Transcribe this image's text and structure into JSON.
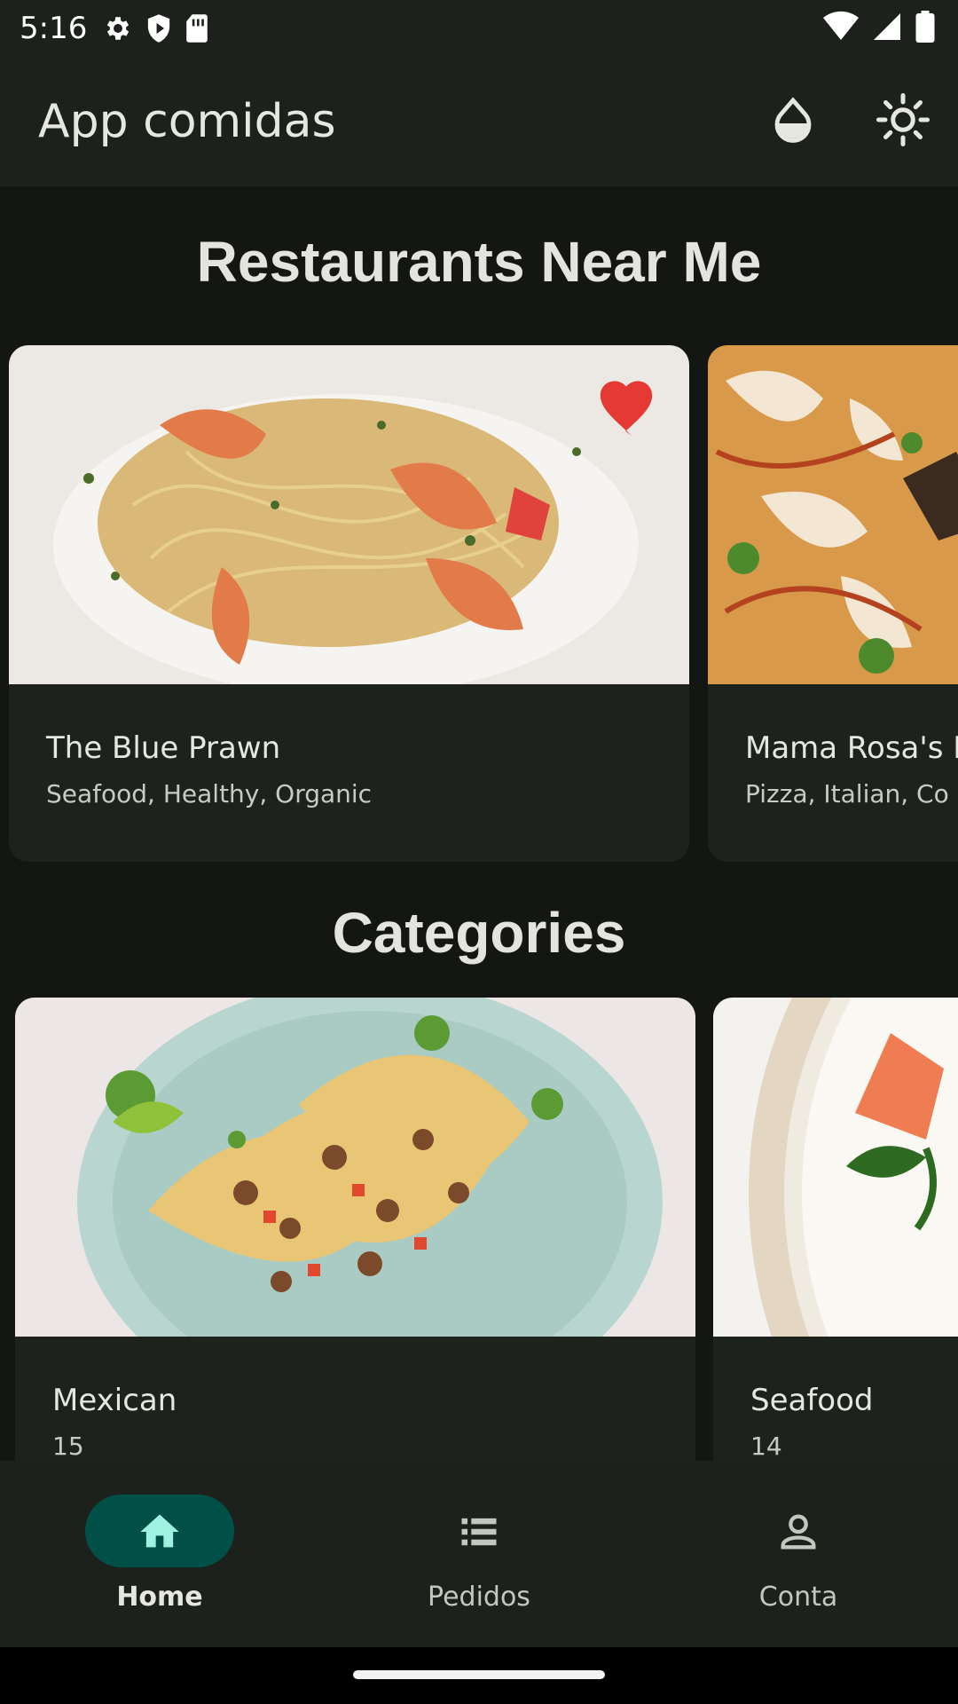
{
  "status_bar": {
    "time": "5:16",
    "left_icons": [
      "settings-icon",
      "shield-icon",
      "sim-card-icon"
    ],
    "right_icons": [
      "wifi-icon",
      "signal-icon",
      "battery-icon"
    ]
  },
  "app_bar": {
    "title": "App comidas",
    "actions": [
      "color-drop-icon",
      "brightness-icon"
    ]
  },
  "restaurants": {
    "title": "Restaurants Near Me",
    "items": [
      {
        "name": "The Blue Prawn",
        "tags": "Seafood, Healthy, Organic",
        "favorite": true
      },
      {
        "name": "Mama Rosa's I",
        "tags": "Pizza, Italian, Co",
        "favorite": false
      }
    ]
  },
  "categories": {
    "title": "Categories",
    "items": [
      {
        "name": "Mexican",
        "count": "15"
      },
      {
        "name": "Seafood",
        "count": "14"
      }
    ]
  },
  "bottom_nav": {
    "items": [
      {
        "label": "Home",
        "icon": "home-icon",
        "active": true
      },
      {
        "label": "Pedidos",
        "icon": "list-icon",
        "active": false
      },
      {
        "label": "Conta",
        "icon": "person-icon",
        "active": false
      }
    ]
  },
  "colors": {
    "background": "#141613",
    "surface": "#1c211c",
    "card": "#1e221d",
    "accent": "#005048",
    "favorite": "#e53935"
  }
}
